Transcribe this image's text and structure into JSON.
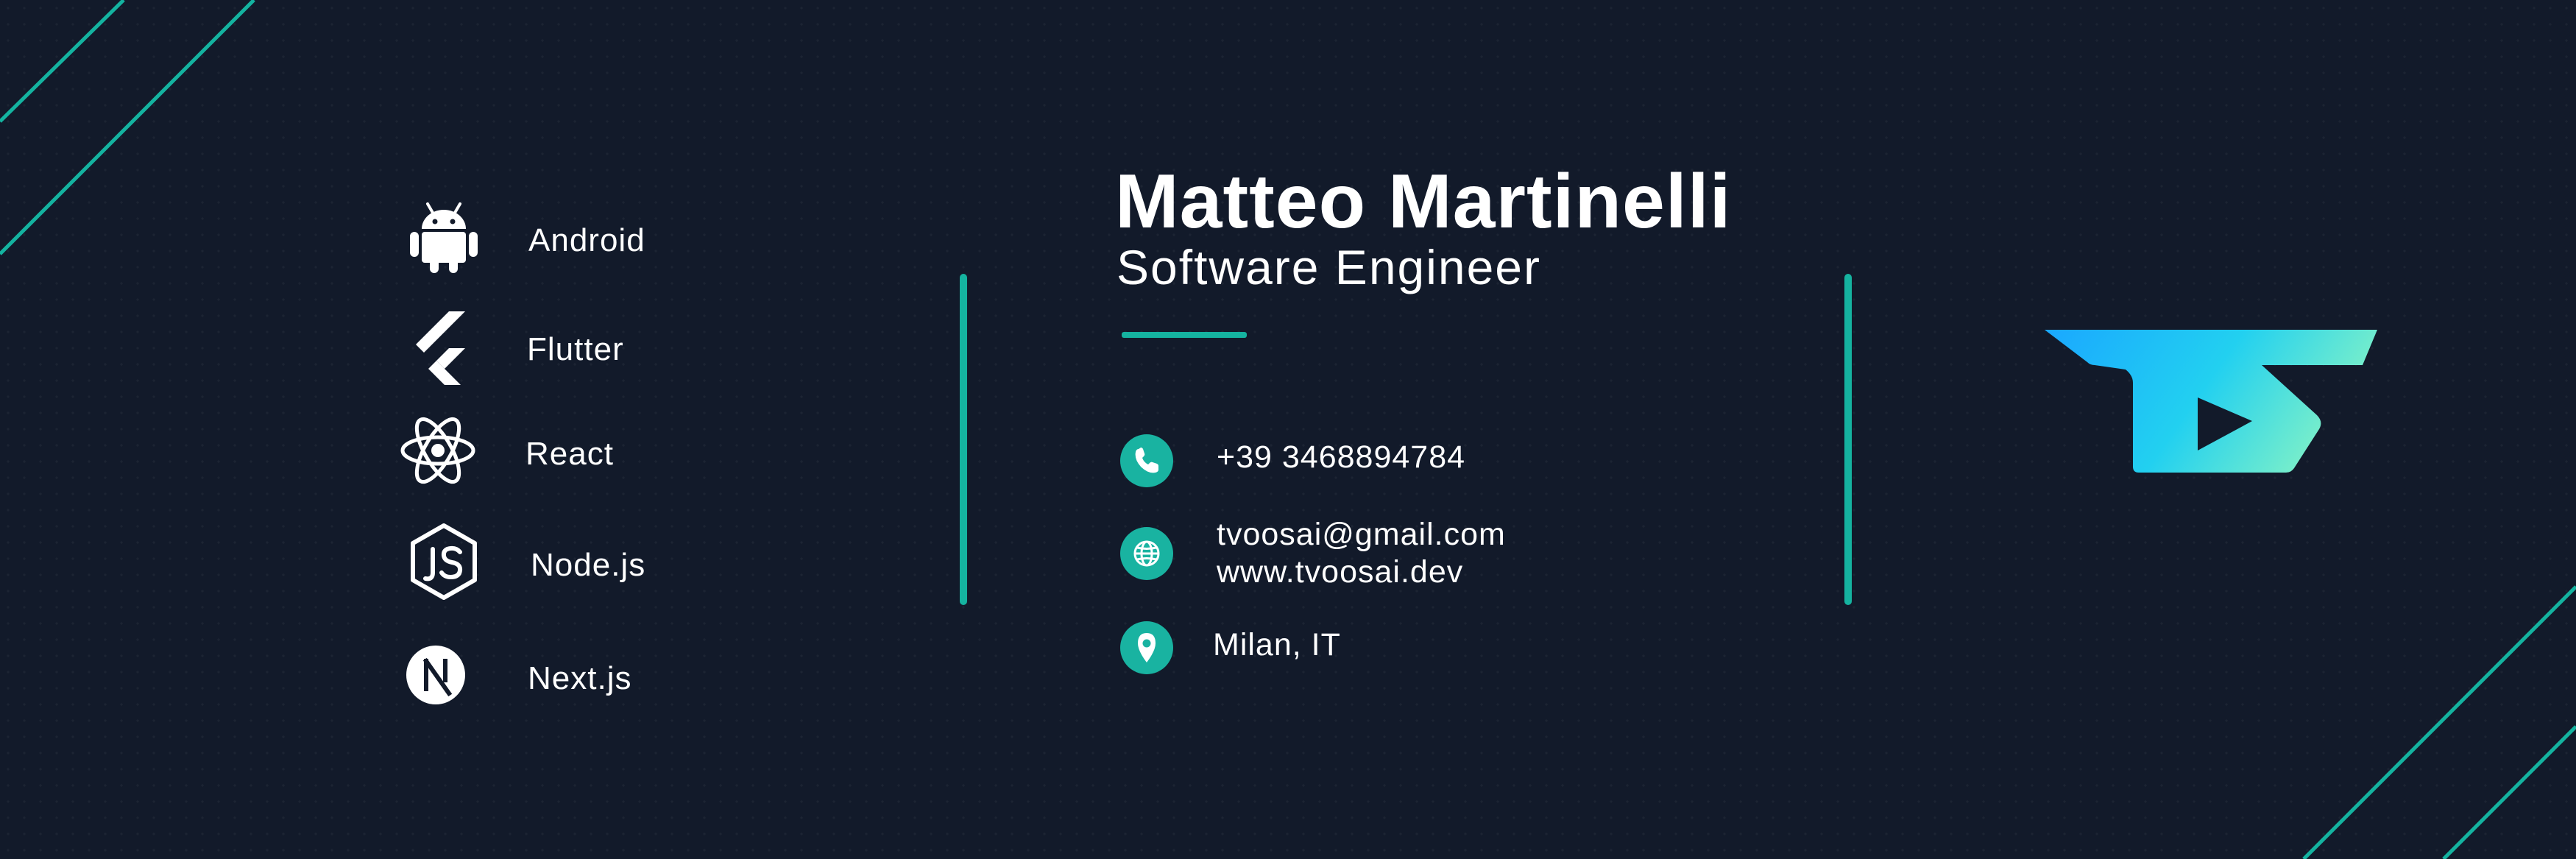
{
  "skills": [
    {
      "label": "Android",
      "icon": "android-icon"
    },
    {
      "label": "Flutter",
      "icon": "flutter-icon"
    },
    {
      "label": "React",
      "icon": "react-icon"
    },
    {
      "label": "Node.js",
      "icon": "nodejs-icon"
    },
    {
      "label": "Next.js",
      "icon": "nextjs-icon"
    }
  ],
  "profile": {
    "name": "Matteo Martinelli",
    "role": "Software Engineer"
  },
  "contacts": {
    "phone": "+39 3468894784",
    "email": "tvoosai@gmail.com",
    "website": "www.tvoosai.dev",
    "location": "Milan, IT"
  },
  "colors": {
    "background": "#121a2a",
    "accent": "#15b3a0",
    "logo_gradient_start": "#1aa8ff",
    "logo_gradient_end": "#7ef0c8"
  },
  "logo": {
    "icon": "ts-monogram-logo"
  }
}
